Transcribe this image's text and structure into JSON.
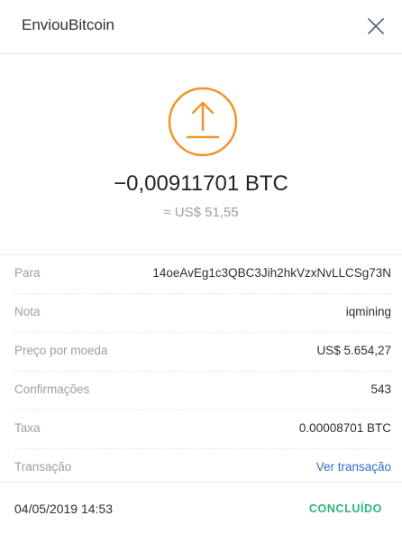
{
  "header": {
    "title": "EnviouBitcoin",
    "close_icon": "close-icon"
  },
  "hero": {
    "icon": "upload-arrow-icon",
    "amount": "−0,00911701 BTC",
    "fiat": "≈ US$ 51,55"
  },
  "details": {
    "rows": [
      {
        "label": "Para",
        "value": "14oeAvEg1c3QBC3Jih2hkVzxNvLLCSg73N"
      },
      {
        "label": "Nota",
        "value": "iqmining"
      },
      {
        "label": "Preço por moeda",
        "value": "US$ 5.654,27"
      },
      {
        "label": "Confirmações",
        "value": "543"
      },
      {
        "label": "Taxa",
        "value": "0.00008701 BTC"
      },
      {
        "label": "Transação",
        "value": "Ver transação"
      }
    ]
  },
  "footer": {
    "date": "04/05/2019 14:53",
    "status": "CONCLUÍDO"
  },
  "colors": {
    "accent_orange": "#f0952a",
    "link_blue": "#2f6fc9",
    "status_green": "#2fb677",
    "muted_text": "#9aa0a8"
  }
}
